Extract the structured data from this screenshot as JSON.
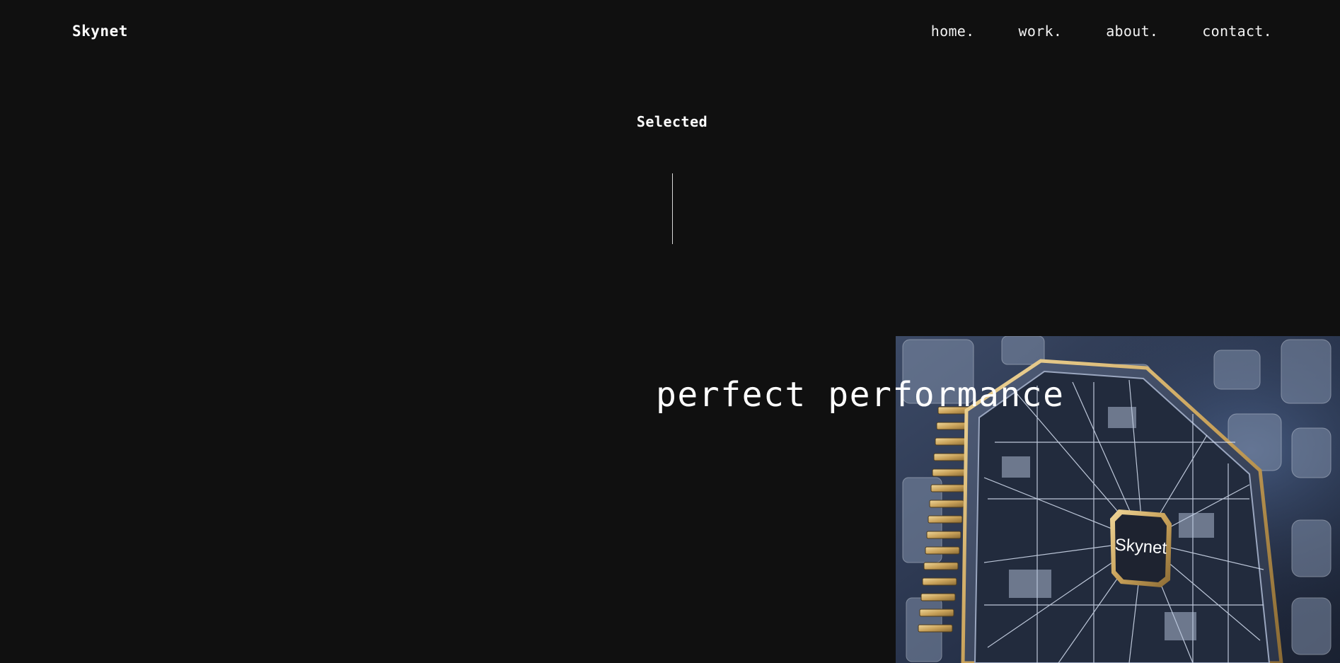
{
  "brand": {
    "name": "Skynet"
  },
  "nav": {
    "items": [
      {
        "label": "home."
      },
      {
        "label": "work."
      },
      {
        "label": "about."
      },
      {
        "label": "contact."
      }
    ]
  },
  "section": {
    "label": "Selected"
  },
  "project": {
    "title": "perfect performance",
    "chip_label": "Skynet"
  },
  "colors": {
    "background": "#101010",
    "text": "#ffffff",
    "chip_gold": "#d8b870",
    "image_blue": "#34425c"
  }
}
